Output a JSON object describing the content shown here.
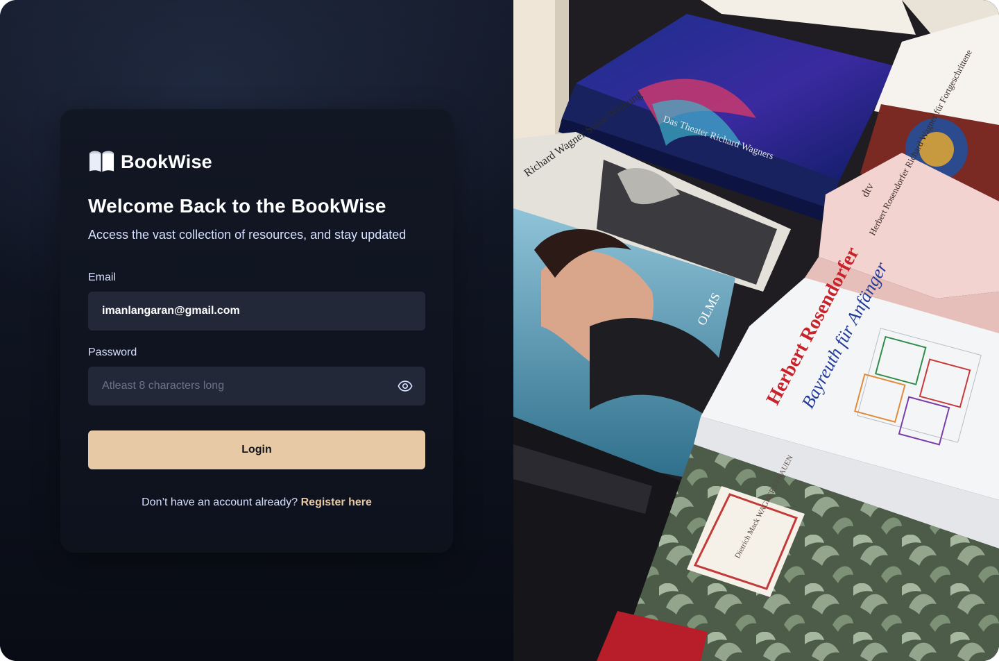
{
  "brand": {
    "name": "BookWise",
    "icon": "open-book-icon"
  },
  "login": {
    "title": "Welcome Back to the BookWise",
    "subtitle": "Access the vast collection of resources, and stay updated",
    "email_label": "Email",
    "email_value": "imanlangaran@gmail.com",
    "password_label": "Password",
    "password_placeholder": "Atleast 8 characters long",
    "password_toggle_icon": "eye-icon",
    "login_button": "Login",
    "register_prompt": "Don’t have an account already?",
    "register_link": "Register here"
  },
  "hero_image": {
    "visible_text": {
      "book1_spine_text": "Das Theater Richard Wagners",
      "book2_title": "Herbert Rosendorfer",
      "book2_subtitle": "Bayreuth für Anfänger",
      "book3_text": "Herbert Rosendorfer Richard Wagner für Fortgeschrittene",
      "book3_publisher": "dtv",
      "book4_publisher": "OLMS",
      "book5_spine": "Richard Wagner Seine Wirkung",
      "book6_text": "Dietrich Mack WAGNERS FRAUEN"
    }
  },
  "theme": {
    "accent": "#e7c9a5",
    "background": "#0b0f1a",
    "card": "#121724",
    "input": "#232839",
    "text_muted": "#d6e0ff"
  }
}
